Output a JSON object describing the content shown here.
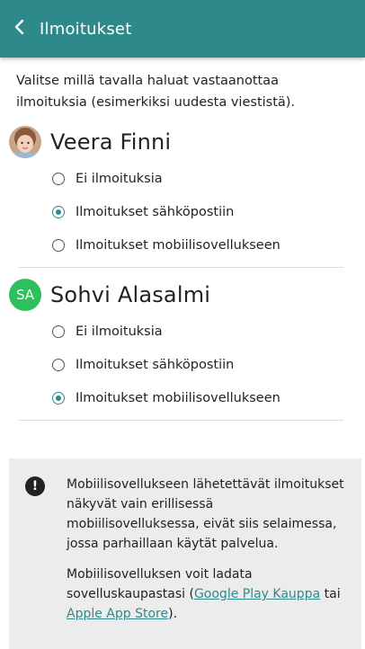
{
  "header": {
    "title": "Ilmoitukset",
    "back_icon": "chevron-left-icon",
    "color": "#2e8a8a"
  },
  "intro": "Valitse millä tavalla haluat vastaanottaa ilmoituksia (esimerkiksi uudesta viestistä).",
  "persons": [
    {
      "name": "Veera Finni",
      "avatar": "photo",
      "options": [
        "Ei ilmoituksia",
        "Ilmoitukset sähköpostiin",
        "Ilmoitukset mobiilisovellukseen"
      ],
      "selected_index": 1
    },
    {
      "name": "Sohvi Alasalmi",
      "avatar_initials": "SA",
      "avatar_color": "#2ec05d",
      "options": [
        "Ei ilmoituksia",
        "Ilmoitukset sähköpostiin",
        "Ilmoitukset mobiilisovellukseen"
      ],
      "selected_index": 2
    }
  ],
  "info": {
    "icon": "exclamation-icon",
    "paragraph1": "Mobiilisovellukseen lähetettävät ilmoitukset näkyvät vain erillisessä mobiilisovelluksessa, eivät siis selaimessa, jossa parhaillaan käytät palvelua.",
    "paragraph2_pre": "Mobiilisovelluksen voit ladata sovelluskaupastasi (",
    "link1": "Google Play Kauppa",
    "paragraph2_mid": " tai ",
    "link2": "Apple App Store",
    "paragraph2_post": ")."
  }
}
